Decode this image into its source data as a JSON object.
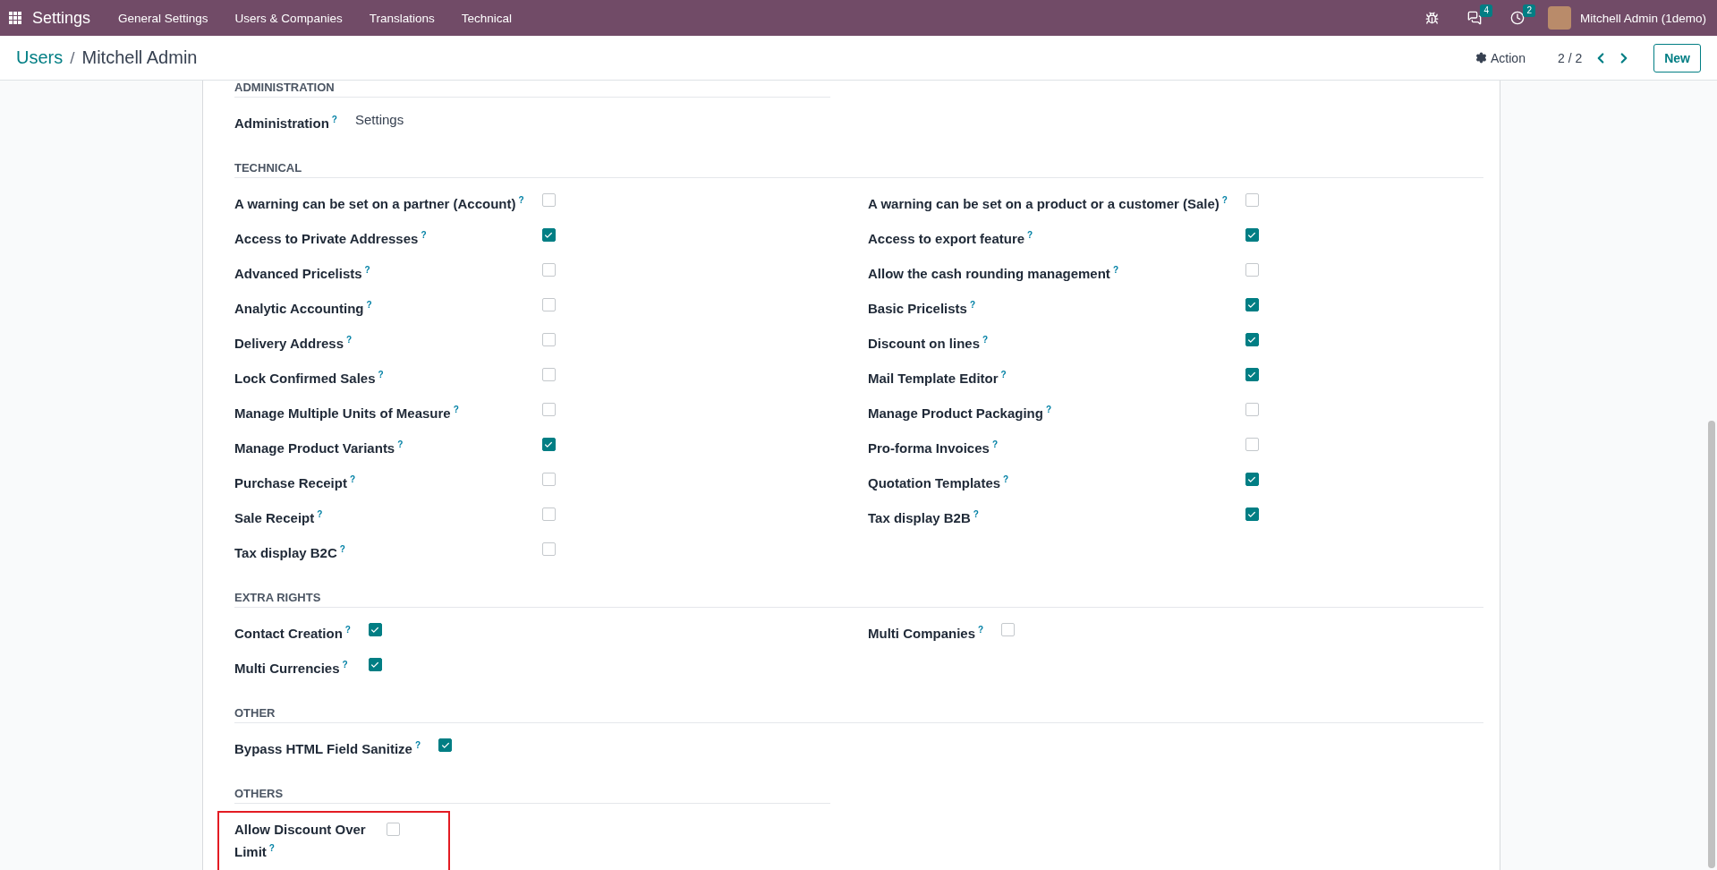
{
  "navbar": {
    "app_name": "Settings",
    "menu": [
      "General Settings",
      "Users & Companies",
      "Translations",
      "Technical"
    ],
    "messages_badge": "4",
    "activities_badge": "2",
    "user": "Mitchell Admin (1demo)"
  },
  "control_panel": {
    "breadcrumb": [
      {
        "label": "Users",
        "kind": "link"
      },
      {
        "label": "Mitchell Admin",
        "kind": "current"
      }
    ],
    "separator": "/",
    "action": "Action",
    "pager": "2 / 2",
    "new_button": "New"
  },
  "sections": [
    {
      "title": "ADMINISTRATION",
      "kind": "select",
      "half": true,
      "highlighted": false,
      "rows": [
        {
          "label": "Administration",
          "help": "?",
          "value": "Settings"
        }
      ]
    },
    {
      "title": "TECHNICAL",
      "kind": "checks",
      "half": false,
      "highlighted": false,
      "columns": [
        [
          {
            "label": "A warning can be set on a partner (Account)",
            "help": "?",
            "checked": false
          },
          {
            "label": "Access to Private Addresses",
            "help": "?",
            "checked": true
          },
          {
            "label": "Advanced Pricelists",
            "help": "?",
            "checked": false
          },
          {
            "label": "Analytic Accounting",
            "help": "?",
            "checked": false
          },
          {
            "label": "Delivery Address",
            "help": "?",
            "checked": false
          },
          {
            "label": "Lock Confirmed Sales",
            "help": "?",
            "checked": false
          },
          {
            "label": "Manage Multiple Units of Measure",
            "help": "?",
            "checked": false
          },
          {
            "label": "Manage Product Variants",
            "help": "?",
            "checked": true
          },
          {
            "label": "Purchase Receipt",
            "help": "?",
            "checked": false
          },
          {
            "label": "Sale Receipt",
            "help": "?",
            "checked": false
          },
          {
            "label": "Tax display B2C",
            "help": "?",
            "checked": false
          }
        ],
        [
          {
            "label": "A warning can be set on a product or a customer (Sale)",
            "help": "?",
            "checked": false
          },
          {
            "label": "Access to export feature",
            "help": "?",
            "checked": true
          },
          {
            "label": "Allow the cash rounding management",
            "help": "?",
            "checked": false
          },
          {
            "label": "Basic Pricelists",
            "help": "?",
            "checked": true
          },
          {
            "label": "Discount on lines",
            "help": "?",
            "checked": true
          },
          {
            "label": "Mail Template Editor",
            "help": "?",
            "checked": true
          },
          {
            "label": "Manage Product Packaging",
            "help": "?",
            "checked": false
          },
          {
            "label": "Pro-forma Invoices",
            "help": "?",
            "checked": false
          },
          {
            "label": "Quotation Templates",
            "help": "?",
            "checked": true
          },
          {
            "label": "Tax display B2B",
            "help": "?",
            "checked": true
          }
        ]
      ]
    },
    {
      "title": "EXTRA RIGHTS",
      "kind": "checks",
      "half": false,
      "highlighted": false,
      "columns": [
        [
          {
            "label": "Contact Creation",
            "help": "?",
            "checked": true
          },
          {
            "label": "Multi Currencies",
            "help": "?",
            "checked": true
          }
        ],
        [
          {
            "label": "Multi Companies",
            "help": "?",
            "checked": false
          }
        ]
      ]
    },
    {
      "title": "OTHER",
      "kind": "checks",
      "half": false,
      "highlighted": false,
      "columns": [
        [
          {
            "label": "Bypass HTML Field Sanitize",
            "help": "?",
            "checked": true
          }
        ]
      ]
    },
    {
      "title": "OTHERS",
      "kind": "checks",
      "half": true,
      "highlighted": true,
      "columns": [
        [
          {
            "label": "Allow Discount Over Limit",
            "help": "?",
            "checked": false
          }
        ]
      ]
    }
  ]
}
